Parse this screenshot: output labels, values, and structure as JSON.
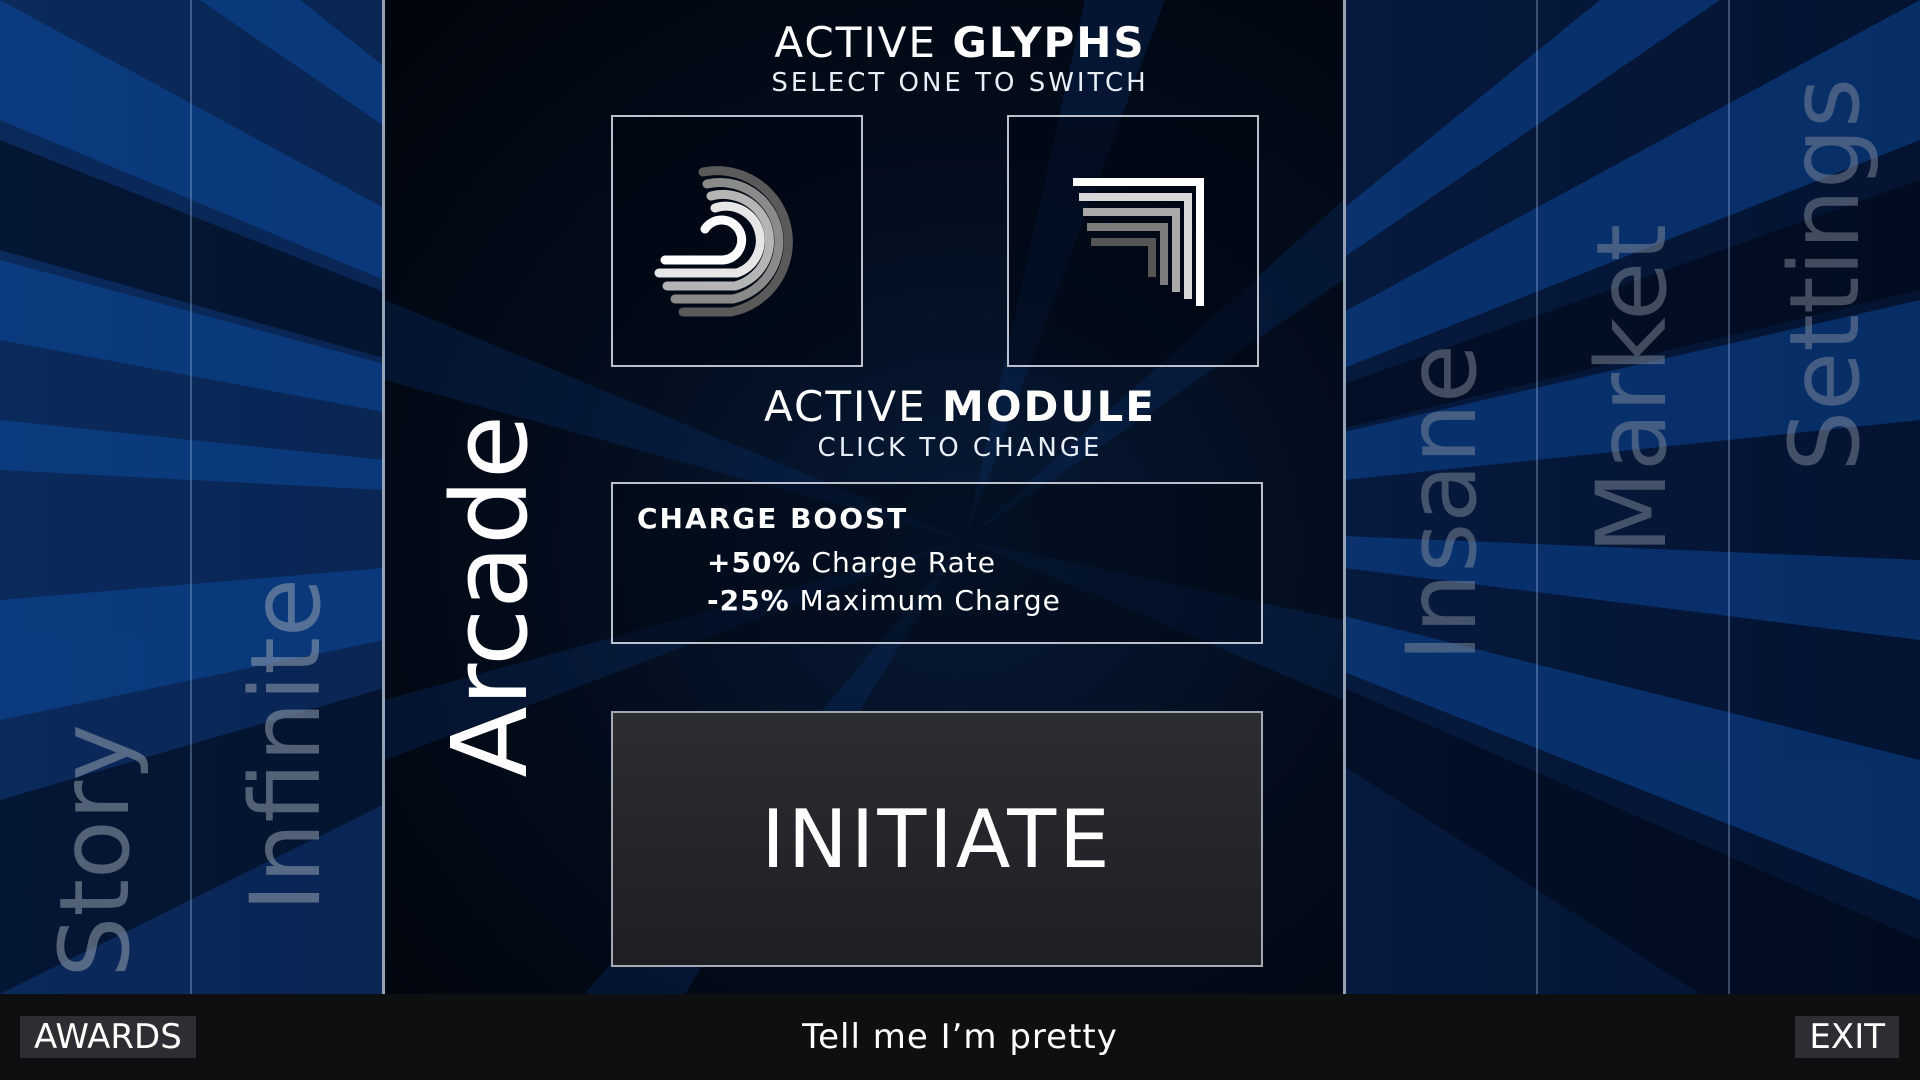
{
  "modes": {
    "story": "Story",
    "infinite": "Infinite",
    "arcade": "Arcade",
    "insane": "Insane",
    "market": "Market",
    "settings": "Settings"
  },
  "glyphs": {
    "heading_light": "ACTIVE",
    "heading_bold": "GLYPHS",
    "subheading": "SELECT ONE TO SWITCH",
    "items": [
      {
        "icon": "swirl-glyph-icon"
      },
      {
        "icon": "corner-lines-glyph-icon"
      }
    ]
  },
  "module": {
    "heading_light": "ACTIVE",
    "heading_bold": "MODULE",
    "subheading": "CLICK TO CHANGE",
    "name": "CHARGE BOOST",
    "effects": [
      {
        "value": "+50%",
        "label": "Charge Rate"
      },
      {
        "value": "-25%",
        "label": "Maximum Charge"
      }
    ]
  },
  "initiate_label": "INITIATE",
  "bottom_bar": {
    "awards": "AWARDS",
    "status": "Tell me I’m pretty",
    "exit": "EXIT"
  },
  "colors": {
    "background": "#020a18",
    "accent_blue": "#0b3f8a",
    "bar": "#0e0f11",
    "button": "#2d2e31"
  }
}
